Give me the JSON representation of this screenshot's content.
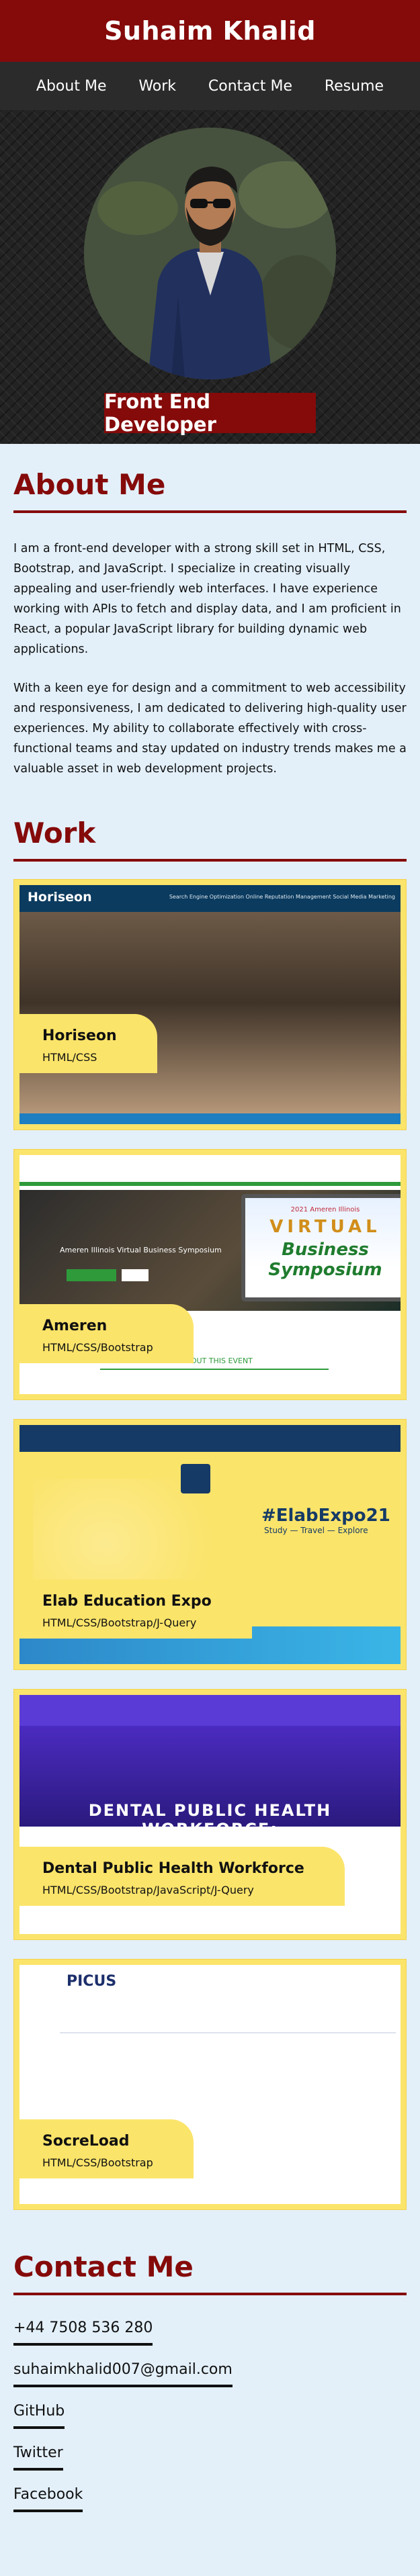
{
  "header": {
    "title": "Suhaim Khalid"
  },
  "nav": {
    "items": [
      {
        "label": "About Me"
      },
      {
        "label": "Work"
      },
      {
        "label": "Contact Me"
      },
      {
        "label": "Resume"
      }
    ]
  },
  "hero": {
    "role": "Front End Developer"
  },
  "about": {
    "heading": "About Me",
    "paragraphs": [
      "I am a front-end developer with a strong skill set in HTML, CSS, Bootstrap, and JavaScript. I specialize in creating visually appealing and user-friendly web interfaces. I have experience working with APIs to fetch and display data, and I am proficient in React, a popular JavaScript library for building dynamic web applications.",
      "With a keen eye for design and a commitment to web accessibility and responsiveness, I am dedicated to delivering high-quality user experiences. My ability to collaborate effectively with cross-functional teams and stay updated on industry trends makes me a valuable asset in web development projects."
    ]
  },
  "work": {
    "heading": "Work",
    "projects": [
      {
        "name": "Horiseon",
        "tech": "HTML/CSS",
        "shot_brand": "Horiseon",
        "shot_nav": "Search Engine Optimization   Online Reputation Management   Social Media Marketing"
      },
      {
        "name": "Ameren",
        "tech": "HTML/CSS/Bootstrap",
        "shot_event": "Ameren Illinois Virtual Business Symposium",
        "shot_line1": "2021 Ameren Illinois",
        "shot_line2": "VIRTUAL",
        "shot_line3": "Business Symposium",
        "shot_sub": "ABOUT THIS EVENT"
      },
      {
        "name": "Elab Education Expo",
        "tech": "HTML/CSS/Bootstrap/J-Query",
        "shot_tag": "#ElabExpo21",
        "shot_tag2": "Study — Travel — Explore"
      },
      {
        "name": "Dental Public Health Workforce",
        "tech": "HTML/CSS/Bootstrap/JavaScript/J-Query",
        "shot_caption": "DENTAL PUBLIC HEALTH WORKFORCE:"
      },
      {
        "name": "SocreLoad",
        "tech": "HTML/CSS/Bootstrap",
        "shot_brand": "PICUS"
      }
    ]
  },
  "contact": {
    "heading": "Contact Me",
    "phone": "+44 7508 536 280",
    "email": "suhaimkhalid007@gmail.com",
    "github": "GitHub",
    "twitter": "Twitter",
    "facebook": "Facebook"
  },
  "colors": {
    "brand": "#850a0a",
    "nav": "#2b2b2b",
    "page": "#e3f0fa",
    "card": "#fbe46a"
  }
}
